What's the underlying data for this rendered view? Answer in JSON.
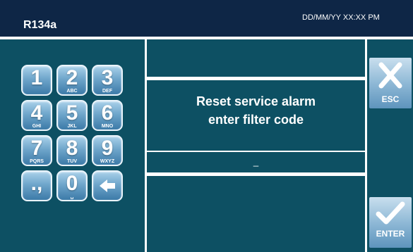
{
  "header": {
    "title": "R134a",
    "datetime": "DD/MM/YY XX:XX PM"
  },
  "message": {
    "line1": "Reset service alarm",
    "line2": "enter filter code"
  },
  "input": {
    "value": "_"
  },
  "keypad": {
    "keys": [
      {
        "digit": "1",
        "letters": ""
      },
      {
        "digit": "2",
        "letters": "ABC"
      },
      {
        "digit": "3",
        "letters": "DEF"
      },
      {
        "digit": "4",
        "letters": "GHI"
      },
      {
        "digit": "5",
        "letters": "JKL"
      },
      {
        "digit": "6",
        "letters": "MNO"
      },
      {
        "digit": "7",
        "letters": "PQRS"
      },
      {
        "digit": "8",
        "letters": "TUV"
      },
      {
        "digit": "9",
        "letters": "WXYZ"
      },
      {
        "digit": ".,",
        "letters": ""
      },
      {
        "digit": "0",
        "letters": "␣"
      },
      {
        "digit": "",
        "letters": "",
        "icon": "backspace-arrow-icon"
      }
    ]
  },
  "actions": {
    "esc_label": "ESC",
    "esc_icon": "close-x-icon",
    "enter_label": "ENTER",
    "enter_icon": "checkmark-icon"
  },
  "colors": {
    "header_bg": "#0e2646",
    "panel_bg": "#0d5063",
    "key_blue": "#6fa6cb",
    "text": "#ffffff"
  }
}
